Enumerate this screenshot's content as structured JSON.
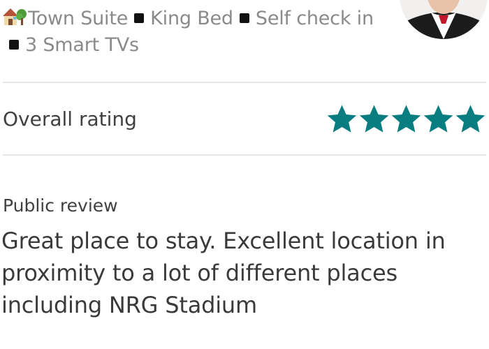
{
  "listing": {
    "icon": "house-with-tree-icon",
    "details": [
      "Town Suite",
      "King Bed",
      "Self check in",
      "3 Smart TVs"
    ]
  },
  "host": {
    "avatar": "host-avatar"
  },
  "rating": {
    "label": "Overall rating",
    "stars": 5,
    "max_stars": 5,
    "star_color": "#0a7d80"
  },
  "review": {
    "label": "Public review",
    "text": "Great place to stay. Excellent location in proximity to a lot of different places including NRG Stadium"
  }
}
